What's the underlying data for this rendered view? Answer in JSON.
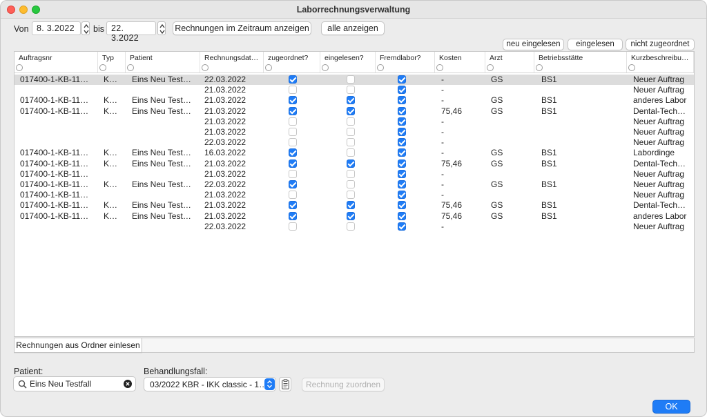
{
  "window": {
    "title": "Laborrechnungsverwaltung"
  },
  "filter": {
    "von_label": "Von",
    "von_value": "8.  3.2022",
    "bis_label": "bis",
    "bis_value": "22.  3.2022",
    "btn_range": "Rechnungen im Zeitraum anzeigen",
    "btn_all": "alle anzeigen"
  },
  "actions": {
    "neu_eingelesen": "neu eingelesen",
    "eingelesen": "eingelesen",
    "nicht_zugeordnet": "nicht zugeordnet"
  },
  "table": {
    "columns": [
      "Auftragsnr",
      "Typ",
      "Patient",
      "Rechnungsdat…",
      "zugeordnet?",
      "eingelesen?",
      "Fremdlabor?",
      "Kosten",
      "Arzt",
      "Betriebsstätte",
      "Kurzbeschreibu…"
    ],
    "rows": [
      {
        "auftrag": "017400-1-KB-11…",
        "typ": "K…",
        "patient": "Eins Neu Test…",
        "datum": "22.03.2022",
        "zug": true,
        "ein": false,
        "fremd": true,
        "kosten": "-",
        "arzt": "GS",
        "bs": "BS1",
        "kurz": "Neuer Auftrag"
      },
      {
        "auftrag": "",
        "typ": "",
        "patient": "",
        "datum": "21.03.2022",
        "zug": false,
        "ein": false,
        "fremd": true,
        "kosten": "-",
        "arzt": "",
        "bs": "",
        "kurz": "Neuer Auftrag"
      },
      {
        "auftrag": "017400-1-KB-11…",
        "typ": "K…",
        "patient": "Eins Neu Test…",
        "datum": "21.03.2022",
        "zug": true,
        "ein": true,
        "fremd": true,
        "kosten": "-",
        "arzt": "GS",
        "bs": "BS1",
        "kurz": "anderes Labor"
      },
      {
        "auftrag": "017400-1-KB-11…",
        "typ": "K…",
        "patient": "Eins Neu Test…",
        "datum": "21.03.2022",
        "zug": true,
        "ein": true,
        "fremd": true,
        "kosten": "75,46",
        "arzt": "GS",
        "bs": "BS1",
        "kurz": "Dental-Tech…"
      },
      {
        "auftrag": "",
        "typ": "",
        "patient": "",
        "datum": "21.03.2022",
        "zug": false,
        "ein": false,
        "fremd": true,
        "kosten": "-",
        "arzt": "",
        "bs": "",
        "kurz": "Neuer Auftrag"
      },
      {
        "auftrag": "",
        "typ": "",
        "patient": "",
        "datum": "21.03.2022",
        "zug": false,
        "ein": false,
        "fremd": true,
        "kosten": "-",
        "arzt": "",
        "bs": "",
        "kurz": "Neuer Auftrag"
      },
      {
        "auftrag": "",
        "typ": "",
        "patient": "",
        "datum": "22.03.2022",
        "zug": false,
        "ein": false,
        "fremd": true,
        "kosten": "-",
        "arzt": "",
        "bs": "",
        "kurz": "Neuer Auftrag"
      },
      {
        "auftrag": "017400-1-KB-11…",
        "typ": "K…",
        "patient": "Eins Neu Test…",
        "datum": "16.03.2022",
        "zug": true,
        "ein": false,
        "fremd": true,
        "kosten": "-",
        "arzt": "GS",
        "bs": "BS1",
        "kurz": "Labordinge"
      },
      {
        "auftrag": "017400-1-KB-11…",
        "typ": "K…",
        "patient": "Eins Neu Test…",
        "datum": "21.03.2022",
        "zug": true,
        "ein": true,
        "fremd": true,
        "kosten": "75,46",
        "arzt": "GS",
        "bs": "BS1",
        "kurz": "Dental-Tech…"
      },
      {
        "auftrag": "017400-1-KB-11…",
        "typ": "",
        "patient": "",
        "datum": "21.03.2022",
        "zug": false,
        "ein": false,
        "fremd": true,
        "kosten": "-",
        "arzt": "",
        "bs": "",
        "kurz": "Neuer Auftrag"
      },
      {
        "auftrag": "017400-1-KB-11…",
        "typ": "K…",
        "patient": "Eins Neu Test…",
        "datum": "22.03.2022",
        "zug": true,
        "ein": false,
        "fremd": true,
        "kosten": "-",
        "arzt": "GS",
        "bs": "BS1",
        "kurz": "Neuer Auftrag"
      },
      {
        "auftrag": "017400-1-KB-11…",
        "typ": "",
        "patient": "",
        "datum": "21.03.2022",
        "zug": false,
        "ein": false,
        "fremd": true,
        "kosten": "-",
        "arzt": "",
        "bs": "",
        "kurz": "Neuer Auftrag"
      },
      {
        "auftrag": "017400-1-KB-11…",
        "typ": "K…",
        "patient": "Eins Neu Test…",
        "datum": "21.03.2022",
        "zug": true,
        "ein": true,
        "fremd": true,
        "kosten": "75,46",
        "arzt": "GS",
        "bs": "BS1",
        "kurz": "Dental-Tech…"
      },
      {
        "auftrag": "017400-1-KB-11…",
        "typ": "K…",
        "patient": "Eins Neu Test…",
        "datum": "21.03.2022",
        "zug": true,
        "ein": true,
        "fremd": true,
        "kosten": "75,46",
        "arzt": "GS",
        "bs": "BS1",
        "kurz": "anderes Labor"
      },
      {
        "auftrag": "",
        "typ": "",
        "patient": "",
        "datum": "22.03.2022",
        "zug": false,
        "ein": false,
        "fremd": true,
        "kosten": "-",
        "arzt": "",
        "bs": "",
        "kurz": "Neuer Auftrag"
      }
    ],
    "selected_row": 0,
    "footer_button": "Rechnungen aus Ordner einlesen"
  },
  "bottom": {
    "patient_label": "Patient:",
    "patient_value": "Eins Neu Testfall",
    "fall_label": "Behandlungsfall:",
    "fall_value": "03/2022 KBR - IKK classic - 1…",
    "btn_zuordnen": "Rechnung zuordnen",
    "btn_ok": "OK"
  },
  "colors": {
    "accent": "#1f7cf6",
    "selection": "#dcdcdc"
  }
}
